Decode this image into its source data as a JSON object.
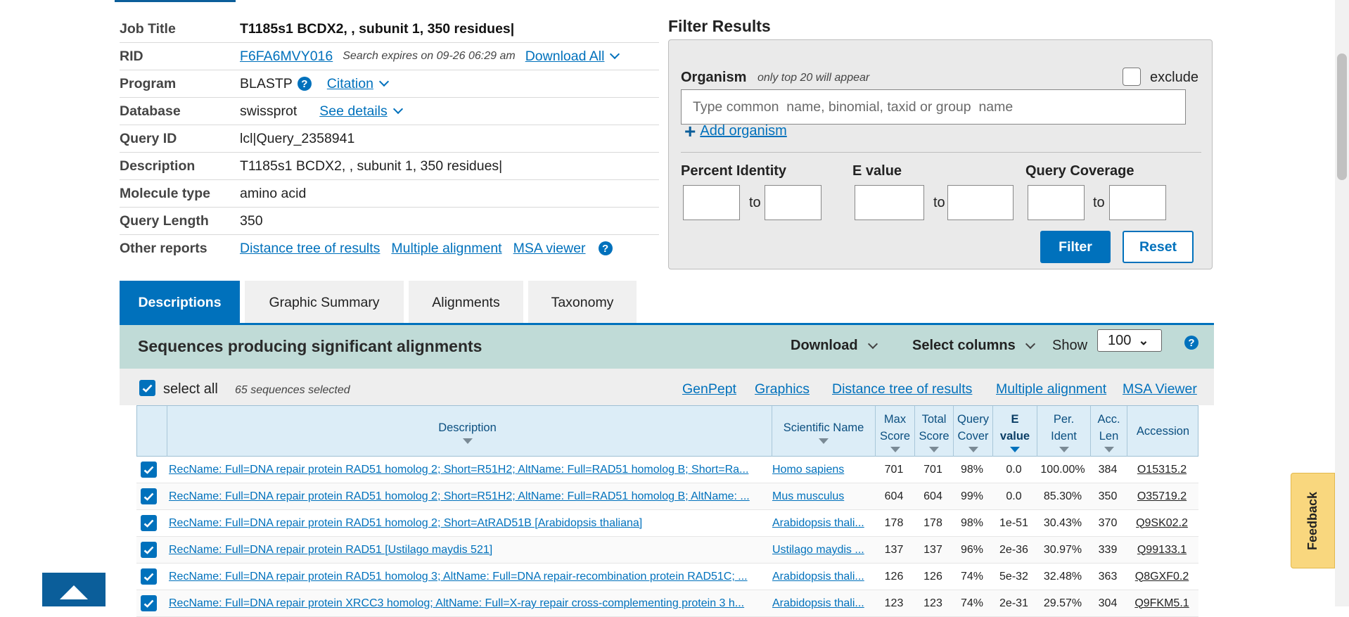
{
  "job": {
    "rows": [
      {
        "label": "Job Title",
        "value": "T1185s1 BCDX2, , subunit 1, 350 residues|"
      },
      {
        "label": "RID",
        "value": "F6FA6MVY016",
        "expires": "Search expires on 09-26 06:29 am",
        "link": "Download All"
      },
      {
        "label": "Program",
        "value": "BLASTP",
        "link": "Citation"
      },
      {
        "label": "Database",
        "value": "swissprot",
        "link": "See details"
      },
      {
        "label": "Query ID",
        "value": "lcl|Query_2358941"
      },
      {
        "label": "Description",
        "value": "T1185s1 BCDX2, , subunit 1, 350 residues|"
      },
      {
        "label": "Molecule type",
        "value": "amino acid"
      },
      {
        "label": "Query Length",
        "value": "350"
      },
      {
        "label": "Other reports",
        "links": [
          "Distance tree of results",
          "Multiple alignment",
          "MSA viewer"
        ]
      }
    ],
    "help": "?"
  },
  "filter": {
    "title": "Filter Results",
    "organism_label": "Organism",
    "organism_hint": "only top 20 will appear",
    "exclude_label": "exclude",
    "organism_placeholder": "Type common  name, binomial, taxid or group  name",
    "add_organism": "Add organism",
    "percent_identity": "Percent Identity",
    "e_value": "E value",
    "query_coverage": "Query Coverage",
    "to": "to",
    "filter_button": "Filter",
    "reset_button": "Reset"
  },
  "tabs": [
    "Descriptions",
    "Graphic Summary",
    "Alignments",
    "Taxonomy"
  ],
  "results": {
    "title": "Sequences producing significant alignments",
    "download": "Download",
    "select_columns": "Select columns",
    "show": "Show",
    "show_value": "100",
    "select_all": "select all",
    "selected_count": "65 sequences selected",
    "links": [
      "GenPept",
      "Graphics",
      "Distance tree of results",
      "Multiple alignment",
      "MSA Viewer"
    ]
  },
  "table": {
    "headers": {
      "description": "Description",
      "scientific_name": "Scientific Name",
      "max_score": [
        "Max",
        "Score"
      ],
      "total_score": [
        "Total",
        "Score"
      ],
      "query_cover": [
        "Query",
        "Cover"
      ],
      "e_value": [
        "E",
        "value"
      ],
      "per_ident": [
        "Per.",
        "Ident"
      ],
      "acc_len": [
        "Acc.",
        "Len"
      ],
      "accession": "Accession"
    },
    "rows": [
      {
        "desc": "RecName: Full=DNA repair protein RAD51 homolog 2; Short=R51H2; AltName: Full=RAD51 homolog B; Short=Ra...",
        "sci": "Homo sapiens",
        "max": "701",
        "total": "701",
        "cover": "98%",
        "e": "0.0",
        "ident": "100.00%",
        "len": "384",
        "acc": "O15315.2"
      },
      {
        "desc": "RecName: Full=DNA repair protein RAD51 homolog 2; Short=R51H2; AltName: Full=RAD51 homolog B; AltName: ...",
        "sci": "Mus musculus",
        "max": "604",
        "total": "604",
        "cover": "99%",
        "e": "0.0",
        "ident": "85.30%",
        "len": "350",
        "acc": "O35719.2"
      },
      {
        "desc": "RecName: Full=DNA repair protein RAD51 homolog 2; Short=AtRAD51B [Arabidopsis thaliana]",
        "sci": "Arabidopsis thali...",
        "max": "178",
        "total": "178",
        "cover": "98%",
        "e": "1e-51",
        "ident": "30.43%",
        "len": "370",
        "acc": "Q9SK02.2"
      },
      {
        "desc": "RecName: Full=DNA repair protein RAD51 [Ustilago maydis 521]",
        "sci": "Ustilago maydis ...",
        "max": "137",
        "total": "137",
        "cover": "96%",
        "e": "2e-36",
        "ident": "30.97%",
        "len": "339",
        "acc": "Q99133.1"
      },
      {
        "desc": "RecName: Full=DNA repair protein RAD51 homolog 3; AltName: Full=DNA repair-recombination protein RAD51C; ...",
        "sci": "Arabidopsis thali...",
        "max": "126",
        "total": "126",
        "cover": "74%",
        "e": "5e-32",
        "ident": "32.48%",
        "len": "363",
        "acc": "Q8GXF0.2"
      },
      {
        "desc": "RecName: Full=DNA repair protein XRCC3 homolog; AltName: Full=X-ray repair cross-complementing protein 3 h...",
        "sci": "Arabidopsis thali...",
        "max": "123",
        "total": "123",
        "cover": "74%",
        "e": "2e-31",
        "ident": "29.57%",
        "len": "304",
        "acc": "Q9FKM5.1"
      }
    ]
  },
  "feedback": "Feedback",
  "colors": {
    "accent": "#0071bc",
    "results_bar": "#c0dbd7",
    "feedback": "#f9d77e"
  }
}
